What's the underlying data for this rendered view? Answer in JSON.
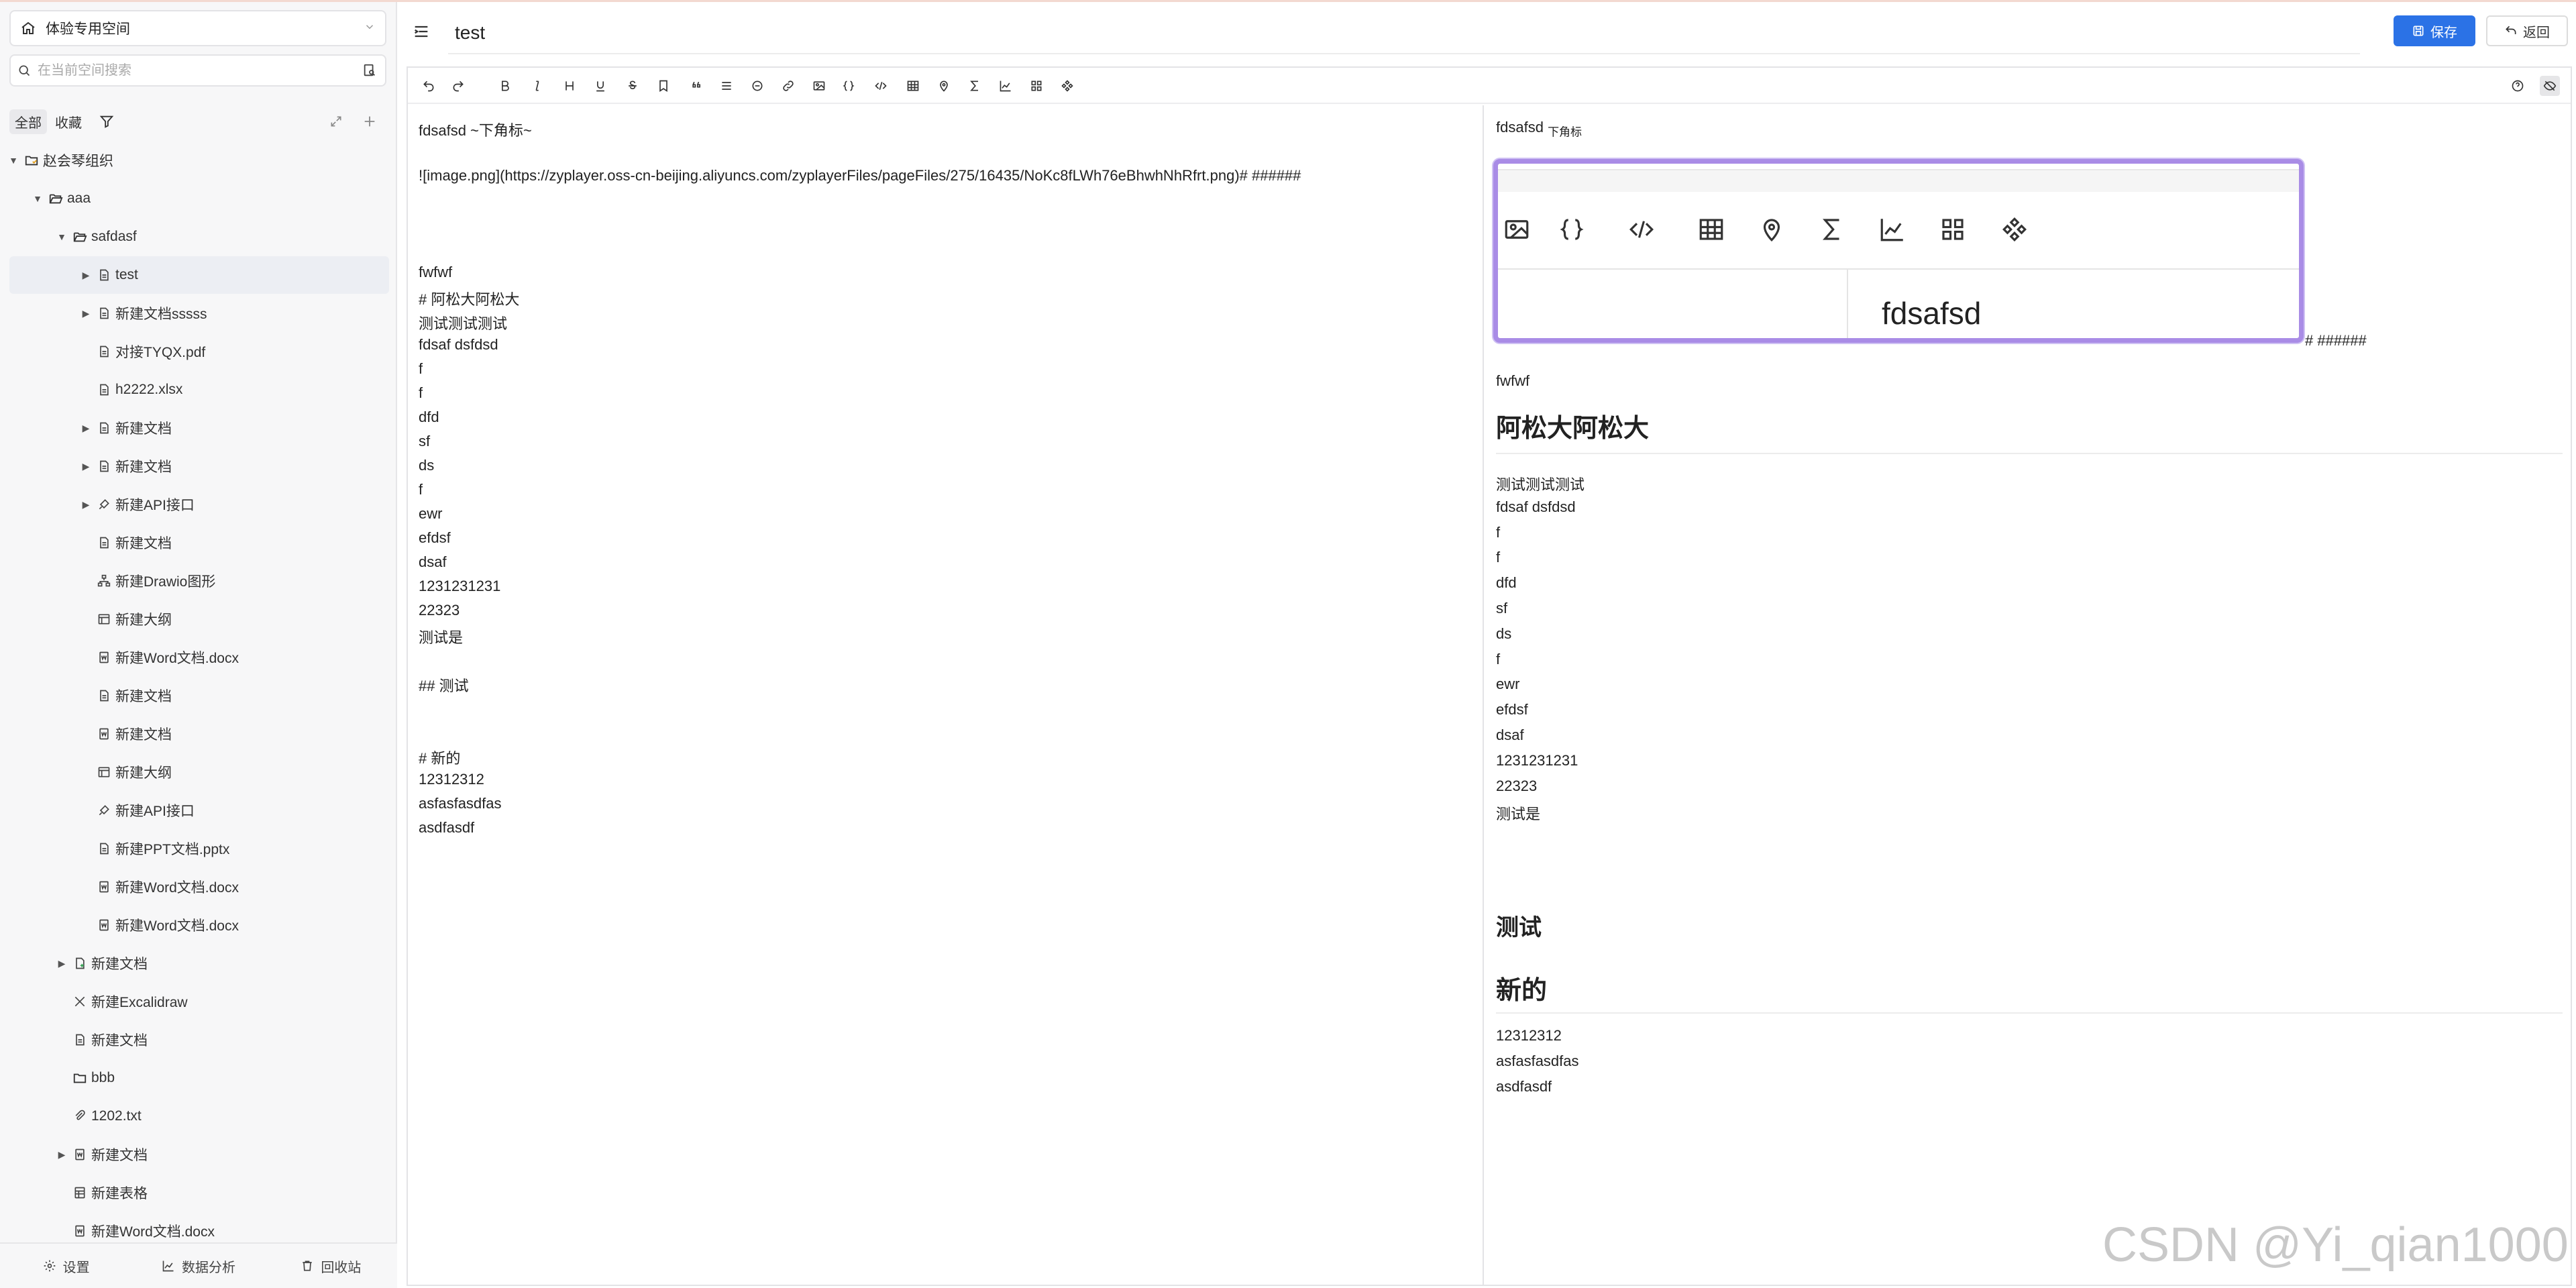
{
  "sidebar": {
    "space_name": "体验专用空间",
    "search_placeholder": "在当前空间搜索",
    "filter_tabs": [
      "全部",
      "收藏"
    ],
    "tree": [
      {
        "label": "赵会琴组织",
        "depth": 0,
        "caret": "down",
        "icon": "folder-org-icon"
      },
      {
        "label": "aaa",
        "depth": 1,
        "caret": "down",
        "icon": "folder-open-icon"
      },
      {
        "label": "safdasf",
        "depth": 2,
        "caret": "down",
        "icon": "folder-open-icon"
      },
      {
        "label": "test",
        "depth": 3,
        "caret": "right",
        "icon": "doc-icon",
        "selected": true
      },
      {
        "label": "新建文档sssss",
        "depth": 3,
        "caret": "right",
        "icon": "doc-icon"
      },
      {
        "label": "对接TYQX.pdf",
        "depth": 3,
        "caret": "",
        "icon": "doc-icon"
      },
      {
        "label": "h2222.xlsx",
        "depth": 3,
        "caret": "",
        "icon": "doc-icon"
      },
      {
        "label": "新建文档",
        "depth": 3,
        "caret": "right",
        "icon": "doc-icon"
      },
      {
        "label": "新建文档",
        "depth": 3,
        "caret": "right",
        "icon": "doc-icon"
      },
      {
        "label": "新建API接口",
        "depth": 3,
        "caret": "right",
        "icon": "api-icon"
      },
      {
        "label": "新建文档",
        "depth": 3,
        "caret": "",
        "icon": "doc-icon"
      },
      {
        "label": "新建Drawio图形",
        "depth": 3,
        "caret": "",
        "icon": "drawio-icon"
      },
      {
        "label": "新建大纲",
        "depth": 3,
        "caret": "",
        "icon": "outline-icon"
      },
      {
        "label": "新建Word文档.docx",
        "depth": 3,
        "caret": "",
        "icon": "word-icon"
      },
      {
        "label": "新建文档",
        "depth": 3,
        "caret": "",
        "icon": "doc-icon"
      },
      {
        "label": "新建文档",
        "depth": 3,
        "caret": "",
        "icon": "word-icon"
      },
      {
        "label": "新建大纲",
        "depth": 3,
        "caret": "",
        "icon": "outline-icon"
      },
      {
        "label": "新建API接口",
        "depth": 3,
        "caret": "",
        "icon": "api-icon"
      },
      {
        "label": "新建PPT文档.pptx",
        "depth": 3,
        "caret": "",
        "icon": "doc-icon"
      },
      {
        "label": "新建Word文档.docx",
        "depth": 3,
        "caret": "",
        "icon": "word-icon"
      },
      {
        "label": "新建Word文档.docx",
        "depth": 3,
        "caret": "",
        "icon": "word-icon"
      },
      {
        "label": "新建文档",
        "depth": 2,
        "caret": "right",
        "icon": "doc-plus-icon"
      },
      {
        "label": "新建Excalidraw",
        "depth": 2,
        "caret": "",
        "icon": "excalidraw-icon"
      },
      {
        "label": "新建文档",
        "depth": 2,
        "caret": "",
        "icon": "doc-icon"
      },
      {
        "label": "bbb",
        "depth": 2,
        "caret": "",
        "icon": "folder-icon"
      },
      {
        "label": "1202.txt",
        "depth": 2,
        "caret": "",
        "icon": "attachment-icon"
      },
      {
        "label": "新建文档",
        "depth": 2,
        "caret": "right",
        "icon": "word-icon"
      },
      {
        "label": "新建表格",
        "depth": 2,
        "caret": "",
        "icon": "sheet-icon"
      },
      {
        "label": "新建Word文档.docx",
        "depth": 2,
        "caret": "",
        "icon": "word-icon"
      }
    ],
    "footer": {
      "settings": "设置",
      "analytics": "数据分析",
      "recycle": "回收站"
    }
  },
  "header": {
    "title": "test",
    "save_label": "保存",
    "back_label": "返回"
  },
  "editor": {
    "source_lines": [
      "fdsafsd ~下角标~",
      "",
      "![image.png](https://zyplayer.oss-cn-beijing.aliyuncs.com/zyplayerFiles/pageFiles/275/16435/NoKc8fLWh76eBhwhNhRfrt.png)# ######",
      "",
      "",
      "",
      "fwfwf",
      "# 阿松大阿松大",
      "测试测试测试",
      "fdsaf dsfdsd",
      "f",
      "f",
      "dfd",
      "sf",
      "ds",
      "f",
      "ewr",
      "efdsf",
      "dsaf",
      "1231231231",
      "22323",
      "测试是",
      "",
      "## 测试",
      "",
      "",
      "# 新的",
      "12312312",
      "asfasfasdfas",
      "asdfasdf"
    ],
    "preview": {
      "first_line": "fdsafsd",
      "subscript": "下角标",
      "image_caption_text": "fdsafsd",
      "after_image": "# ######",
      "p1": "fwfwf",
      "h1_a": "阿松大阿松大",
      "lines_a": [
        "测试测试测试",
        "fdsaf dsfdsd",
        "f",
        "f",
        "dfd",
        "sf",
        "ds",
        "f",
        "ewr",
        "efdsf",
        "dsaf",
        "1231231231",
        "22323",
        "测试是"
      ],
      "h2": "测试",
      "h1_b": "新的",
      "lines_b": [
        "12312312",
        "asfasfasdfas",
        "asdfasdf"
      ]
    }
  },
  "watermark": "CSDN @Yi_qian1000",
  "colors": {
    "accent": "#2b72e6",
    "image_border": "#a98ce6"
  }
}
